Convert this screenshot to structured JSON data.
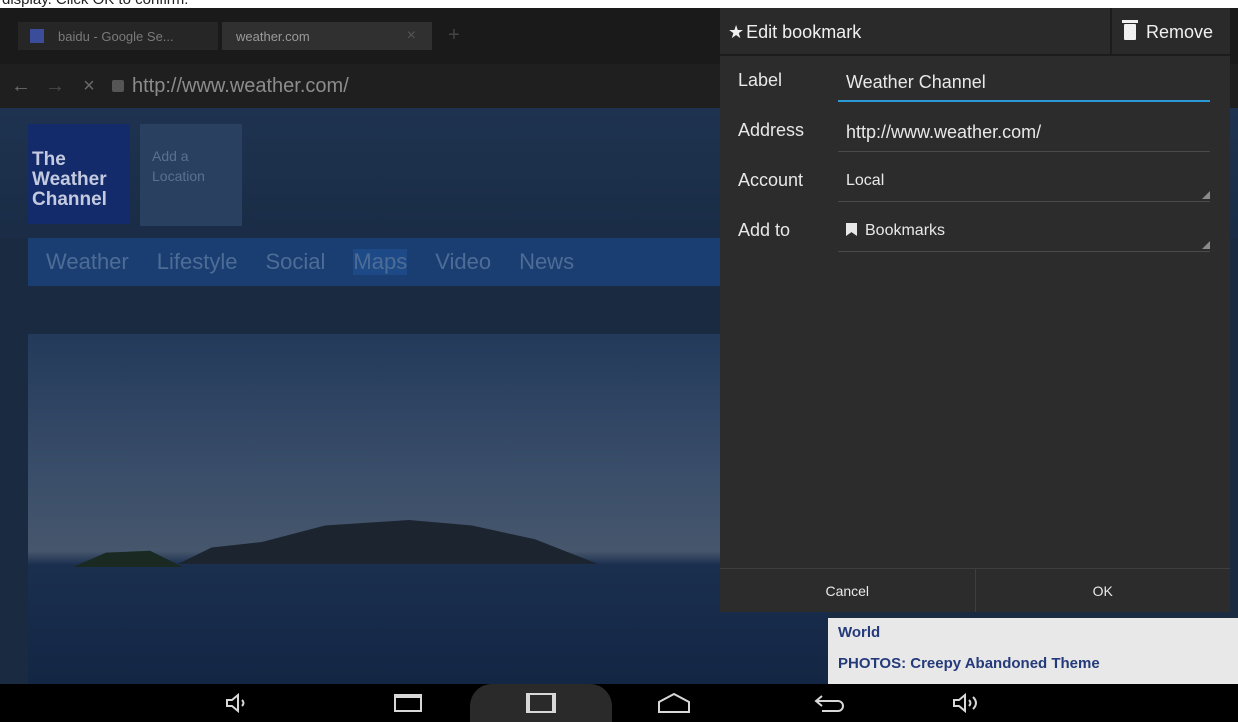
{
  "caption": "display. Click OK to confirm.",
  "browser": {
    "tabs": [
      {
        "label": "baidu - Google Se..."
      },
      {
        "label": "weather.com",
        "close": "×"
      }
    ],
    "new_tab": "+",
    "url": "http://www.weather.com/",
    "icons": {
      "back": "←",
      "forward": "→",
      "stop": "×"
    }
  },
  "page": {
    "logo": "The Weather Channel",
    "add_location": "Add a Location",
    "add_location_plus": "+",
    "menu": [
      "Weather",
      "Lifestyle",
      "Social",
      "Maps",
      "Video",
      "News"
    ],
    "side_links": [
      "World",
      "PHOTOS: Creepy Abandoned Theme"
    ]
  },
  "dialog": {
    "title": "Edit bookmark",
    "remove": "Remove",
    "fields": {
      "label": {
        "label": "Label",
        "value": "Weather Channel"
      },
      "address": {
        "label": "Address",
        "value": "http://www.weather.com/"
      },
      "account": {
        "label": "Account",
        "value": "Local"
      },
      "add_to": {
        "label": "Add to",
        "value": "Bookmarks"
      }
    },
    "cancel": "Cancel",
    "ok": "OK"
  },
  "system_bar": {
    "icons": [
      "volume-down-icon",
      "recents-icon",
      "screenshot-icon",
      "home-icon",
      "back-icon",
      "volume-up-icon"
    ]
  }
}
